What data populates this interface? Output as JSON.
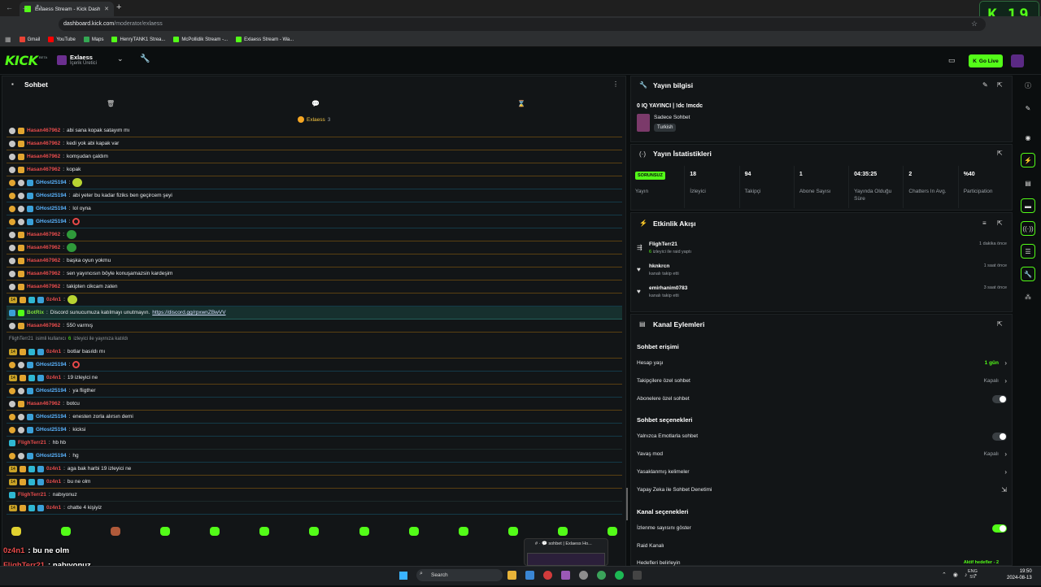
{
  "browser": {
    "tab_title": "Exlaess Stream - Kick Dashboard",
    "url_host": "dashboard.kick.com",
    "url_path": "/moderator/exlaess",
    "bookmarks": [
      {
        "label": "Gmail",
        "color": "#ea4335"
      },
      {
        "label": "YouTube",
        "color": "#ff0000"
      },
      {
        "label": "Maps",
        "color": "#34a853"
      },
      {
        "label": "HenryTANK1 Strea...",
        "color": "#53fc18"
      },
      {
        "label": "McPollidik Stream -...",
        "color": "#53fc18"
      },
      {
        "label": "Exlaess Stream - Wa...",
        "color": "#53fc18"
      }
    ]
  },
  "overlay_counter": {
    "letter": "K",
    "value": "19"
  },
  "header": {
    "logo": "KICK",
    "logo_badge": "BETA",
    "channel_name": "Exlaess",
    "channel_role": "İçerik Üretici",
    "go_live": "Go Live",
    "accent": "#53fc18"
  },
  "chat": {
    "title": "Sohbet",
    "pinned_user": "Exlaess",
    "pinned_count": "3",
    "messages": [
      {
        "style": "orange",
        "badges": [
          "mod",
          "sub"
        ],
        "user": "Hasan467962",
        "ucolor": "red",
        "text": "abi sana kopak satayım mı"
      },
      {
        "style": "orange",
        "badges": [
          "mod",
          "sub"
        ],
        "user": "Hasan467962",
        "ucolor": "red",
        "text": "kedi yok abi kapak var"
      },
      {
        "style": "orange",
        "badges": [
          "mod",
          "sub"
        ],
        "user": "Hasan467962",
        "ucolor": "red",
        "text": "komşudan çaldım"
      },
      {
        "style": "orange",
        "badges": [
          "mod",
          "sub"
        ],
        "user": "Hasan467962",
        "ucolor": "red",
        "text": "kopak"
      },
      {
        "style": "blue",
        "badges": [
          "gold",
          "mod",
          "vip"
        ],
        "user": "GHost25194",
        "ucolor": "blue",
        "text": "",
        "emote": "yellow"
      },
      {
        "style": "blue",
        "badges": [
          "gold",
          "mod",
          "vip"
        ],
        "user": "GHost25194",
        "ucolor": "blue",
        "text": "abi yeter bu kadar fiziks ben geçircem şeyi"
      },
      {
        "style": "blue",
        "badges": [
          "gold",
          "mod",
          "vip"
        ],
        "user": "GHost25194",
        "ucolor": "blue",
        "text": "lol oyna"
      },
      {
        "style": "blue",
        "badges": [
          "gold",
          "mod",
          "vip"
        ],
        "user": "GHost25194",
        "ucolor": "blue",
        "text": "",
        "emote": "ring"
      },
      {
        "style": "orange",
        "badges": [
          "mod",
          "sub"
        ],
        "user": "Hasan467962",
        "ucolor": "red",
        "text": "",
        "emote": "frog"
      },
      {
        "style": "orange",
        "badges": [
          "mod",
          "sub"
        ],
        "user": "Hasan467962",
        "ucolor": "red",
        "text": "",
        "emote": "frog"
      },
      {
        "style": "orange",
        "badges": [
          "mod",
          "sub"
        ],
        "user": "Hasan467962",
        "ucolor": "red",
        "text": "başka oyun yokmu"
      },
      {
        "style": "orange",
        "badges": [
          "mod",
          "sub"
        ],
        "user": "Hasan467962",
        "ucolor": "red",
        "text": "sen yayıncısın böyle konuşamazsin kardeşim"
      },
      {
        "style": "orange",
        "badges": [
          "mod",
          "sub"
        ],
        "user": "Hasan467962",
        "ucolor": "red",
        "text": "takipten cikcam zaten"
      },
      {
        "style": "blue",
        "badges": [
          "num",
          "sub",
          "gift",
          "vip"
        ],
        "user": "0z4n1",
        "ucolor": "red",
        "text": "",
        "emote": "yellow"
      },
      {
        "style": "highlight",
        "badges": [
          "vip",
          "green"
        ],
        "user": "BotRix",
        "ucolor": "green",
        "text": "Discord sunucumuza katılmayı unutmayın.",
        "link": "https://discord.gg/rpxwnZBwVV"
      },
      {
        "style": "orange",
        "badges": [
          "mod",
          "sub"
        ],
        "user": "Hasan467962",
        "ucolor": "red",
        "text": "550 varmış"
      },
      {
        "system": true,
        "user": "FlighTerr21",
        "text_a": "isimli kullanıcı",
        "count": "6",
        "text_b": "izleyici ile yayınıza katıldı"
      },
      {
        "style": "orange",
        "badges": [
          "num",
          "sub",
          "gift",
          "vip"
        ],
        "user": "0z4n1",
        "ucolor": "red",
        "text": "botlar basıldı mı"
      },
      {
        "style": "blue",
        "badges": [
          "gold",
          "mod",
          "vip"
        ],
        "user": "GHost25194",
        "ucolor": "blue",
        "text": "",
        "emote": "ring"
      },
      {
        "style": "orange",
        "badges": [
          "num",
          "sub",
          "gift",
          "vip"
        ],
        "user": "0z4n1",
        "ucolor": "red",
        "text": "19 izleyici ne"
      },
      {
        "style": "blue",
        "badges": [
          "gold",
          "mod",
          "vip"
        ],
        "user": "GHost25194",
        "ucolor": "blue",
        "text": "ya fligther"
      },
      {
        "style": "orange",
        "badges": [
          "mod",
          "sub"
        ],
        "user": "Hasan467962",
        "ucolor": "red",
        "text": "botcu"
      },
      {
        "style": "blue",
        "badges": [
          "gold",
          "mod",
          "vip"
        ],
        "user": "GHost25194",
        "ucolor": "blue",
        "text": "enesten zorla alırsın demi"
      },
      {
        "style": "blue",
        "badges": [
          "gold",
          "mod",
          "vip"
        ],
        "user": "GHost25194",
        "ucolor": "blue",
        "text": "kicksi"
      },
      {
        "style": "plain",
        "badges": [
          "gift"
        ],
        "user": "FlighTerr21",
        "ucolor": "red",
        "text": "hb hb"
      },
      {
        "style": "blue",
        "badges": [
          "gold",
          "mod",
          "vip"
        ],
        "user": "GHost25194",
        "ucolor": "blue",
        "text": "hg"
      },
      {
        "style": "orange",
        "badges": [
          "num",
          "sub",
          "gift",
          "vip"
        ],
        "user": "0z4n1",
        "ucolor": "red",
        "text": "aga bak harbi 19 izleyici ne"
      },
      {
        "style": "orange",
        "badges": [
          "num",
          "sub",
          "gift",
          "vip"
        ],
        "user": "0z4n1",
        "ucolor": "red",
        "text": "bu ne olm"
      },
      {
        "style": "plain",
        "badges": [
          "gift"
        ],
        "user": "FlighTerr21",
        "ucolor": "red",
        "text": "nabıyonuz"
      },
      {
        "style": "blue",
        "badges": [
          "num",
          "sub",
          "gift",
          "vip"
        ],
        "user": "0z4n1",
        "ucolor": "red",
        "text": "chatte 4 kişiyiz"
      }
    ],
    "num_badge": "14"
  },
  "overlay_lines": [
    {
      "user": "0z4n1",
      "text": ": bu ne olm"
    },
    {
      "user": "FlighTerr21",
      "text": ": nabıyonuz"
    },
    {
      "user": "0z4n1",
      "text": ": chatte 4 kişiyiz"
    }
  ],
  "stream_info": {
    "title": "Yayın bilgisi",
    "stream_title": "0 IQ YAYINCI | !dc !mcdc",
    "category": "Sadece Sohbet",
    "tag": "Turkish"
  },
  "stats": {
    "title": "Yayın İstatistikleri",
    "items": [
      {
        "value": "SORUNSUZ",
        "label": "Yayın",
        "pill": true
      },
      {
        "value": "18",
        "label": "İzleyici"
      },
      {
        "value": "94",
        "label": "Takipçi"
      },
      {
        "value": "1",
        "label": "Abone Sayısı"
      },
      {
        "value": "04:35:25",
        "label": "Yayında Olduğu Süre"
      },
      {
        "value": "2",
        "label": "Chatters In Avg."
      },
      {
        "value": "%40",
        "label": "Participation"
      }
    ]
  },
  "activity": {
    "title": "Etkinlik Akışı",
    "events": [
      {
        "user": "FlighTerr21",
        "count": "6",
        "detail": "izleyici ile raid yaptı",
        "time": "1 dakika önce",
        "icon": "raid-icon"
      },
      {
        "user": "hknkrcn",
        "detail": "kanalı takip etti",
        "time": "1 saat önce",
        "icon": "heart-icon"
      },
      {
        "user": "emirhanim0783",
        "detail": "kanalı takip etti",
        "time": "3 saat önce",
        "icon": "heart-icon"
      }
    ]
  },
  "channel_actions": {
    "title": "Kanal Eylemleri",
    "chat_access_title": "Sohbet erişimi",
    "account_age_label": "Hesap yaşı",
    "account_age_value": "1 gün",
    "followers_only_label": "Takipçilere özel sohbet",
    "followers_only_value": "Kapalı",
    "subs_only_label": "Abonelere özel sohbet",
    "chat_options_title": "Sohbet seçenekleri",
    "emotes_only_label": "Yalnızca Emotlarla sohbet",
    "slow_mode_label": "Yavaş mod",
    "slow_mode_value": "Kapalı",
    "banned_words_label": "Yasaklanmış kelimeler",
    "ai_moderation_label": "Yapay Zeka ile Sohbet Denetimi",
    "channel_options_title": "Kanal seçenekleri",
    "show_viewers_label": "İzlenme sayısını göster",
    "raid_label": "Raid Kanalı",
    "goals_label": "Hedefleri belirleyin",
    "goals_value": "Aktif hedefler - 2"
  },
  "taskbar": {
    "search": "Search",
    "lang_top": "ENG",
    "lang_bottom": "SV",
    "time": "19:50",
    "date": "2024-08-13",
    "thumb_title": "# · 💬 sohbet | Exlaess Ho..."
  }
}
